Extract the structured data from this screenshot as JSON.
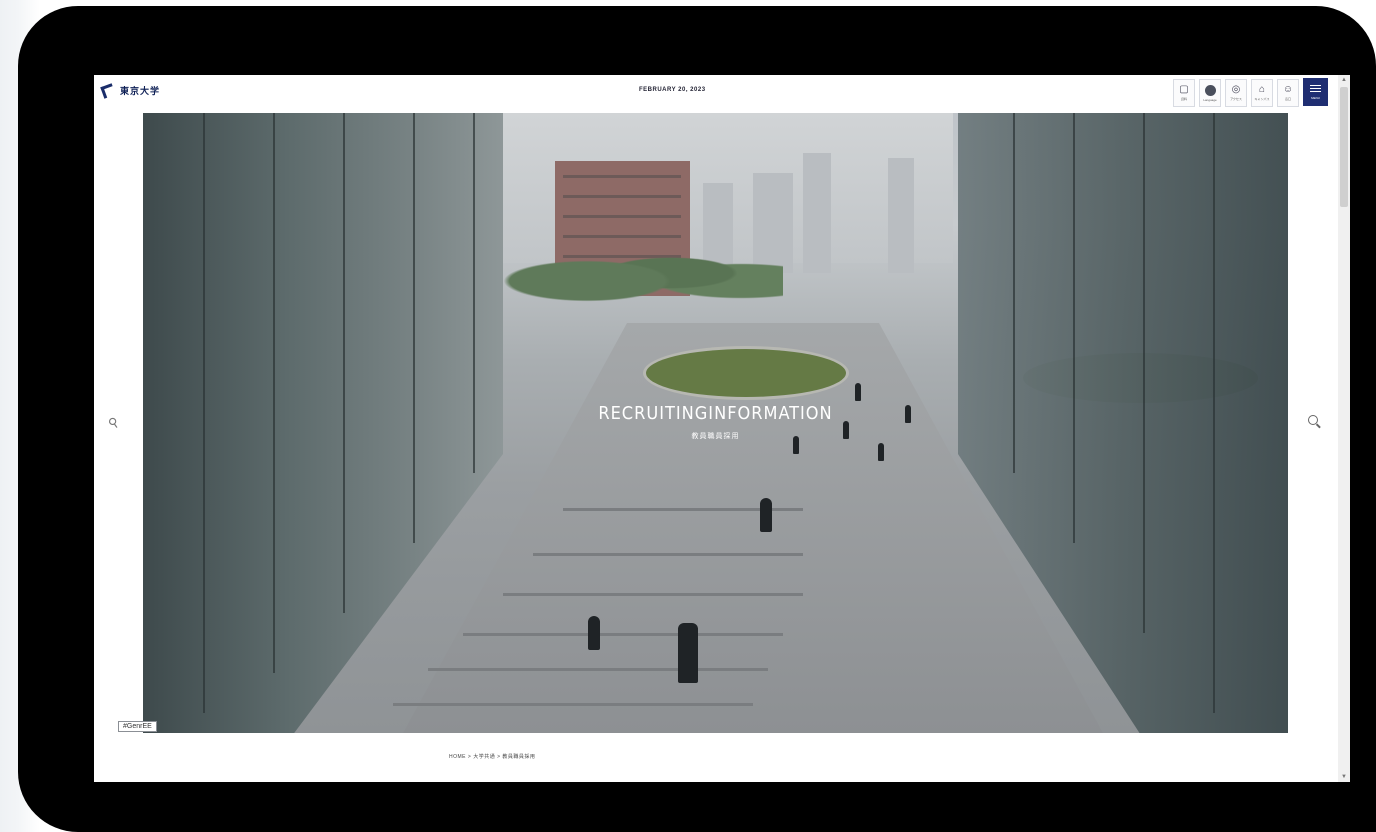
{
  "header": {
    "logo_text": "東京大学",
    "date": "FEBRUARY 20, 2023",
    "buttons": [
      {
        "icon": "document-icon",
        "label": "資料"
      },
      {
        "icon": "globe-icon",
        "label": "Language"
      },
      {
        "icon": "access-icon",
        "label": "アクセス"
      },
      {
        "icon": "campus-icon",
        "label": "キャンパス"
      },
      {
        "icon": "contact-icon",
        "label": "窓口"
      }
    ],
    "menu_label": "MENU"
  },
  "hero": {
    "title": "RECRUITINGINFORMATION",
    "subtitle": "教員職員採用"
  },
  "badge": "#GenrEE",
  "breadcrumb": "HOME > 大学共通 > 教員職員採用",
  "colors": {
    "brand": "#1f2e72",
    "frame": "#000000"
  }
}
